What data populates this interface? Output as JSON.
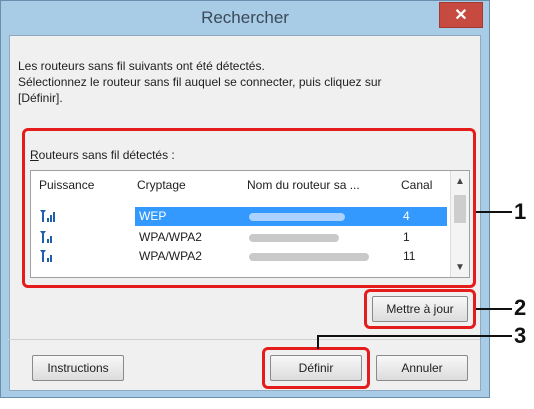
{
  "window": {
    "title": "Rechercher",
    "close_label": "✕"
  },
  "description": {
    "line1": "Les routeurs sans fil suivants ont été détectés.",
    "line2": "Sélectionnez le routeur sans fil auquel se connecter, puis cliquez sur",
    "line3": "[Définir]."
  },
  "list": {
    "label": "Routeurs sans fil détectés :",
    "label_accel": "R",
    "label_rest": "outeurs sans fil détectés :",
    "columns": [
      "Puissance",
      "Cryptage",
      "Nom du routeur sa ...",
      "Canal"
    ],
    "rows": [
      {
        "encryption": "WEP",
        "channel": "4",
        "selected": true
      },
      {
        "encryption": "WPA/WPA2",
        "channel": "1",
        "selected": false
      },
      {
        "encryption": "WPA/WPA2",
        "channel": "11",
        "selected": false
      }
    ]
  },
  "buttons": {
    "update": "Mettre à jour",
    "instructions": "Instructions",
    "define": "Définir",
    "cancel": "Annuler"
  },
  "callouts": [
    "1",
    "2",
    "3"
  ],
  "colors": {
    "highlight": "#e51c1c",
    "selection": "#3399ff",
    "close": "#c74a40",
    "frame": "#a8cbe6"
  }
}
